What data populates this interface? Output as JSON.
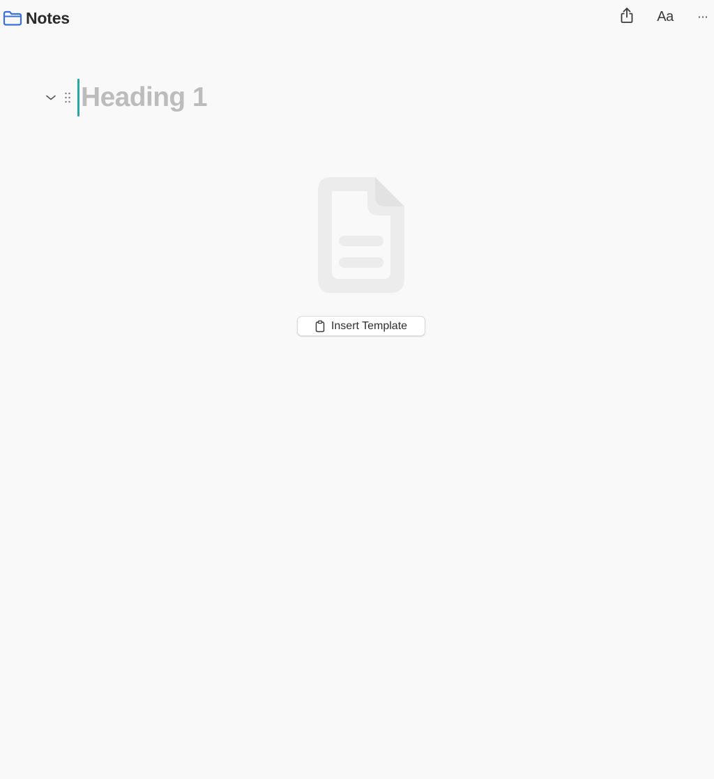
{
  "header": {
    "folder": {
      "label": "Notes",
      "icon": "folder-icon",
      "color": "#3b6fe0"
    },
    "actions": {
      "share": {
        "icon": "share-icon"
      },
      "font": {
        "label": "Aa",
        "icon": "text-format-icon"
      },
      "more": {
        "label": "···",
        "icon": "more-icon"
      }
    }
  },
  "editor": {
    "block_type": "Heading 1",
    "placeholder": "Heading 1",
    "caret_color": "#2ba6a6",
    "collapse_icon": "chevron-down-icon",
    "drag_icon": "drag-handle-icon"
  },
  "empty_state": {
    "icon": "document-icon",
    "button": {
      "label": "Insert Template",
      "icon": "clipboard-icon"
    }
  }
}
